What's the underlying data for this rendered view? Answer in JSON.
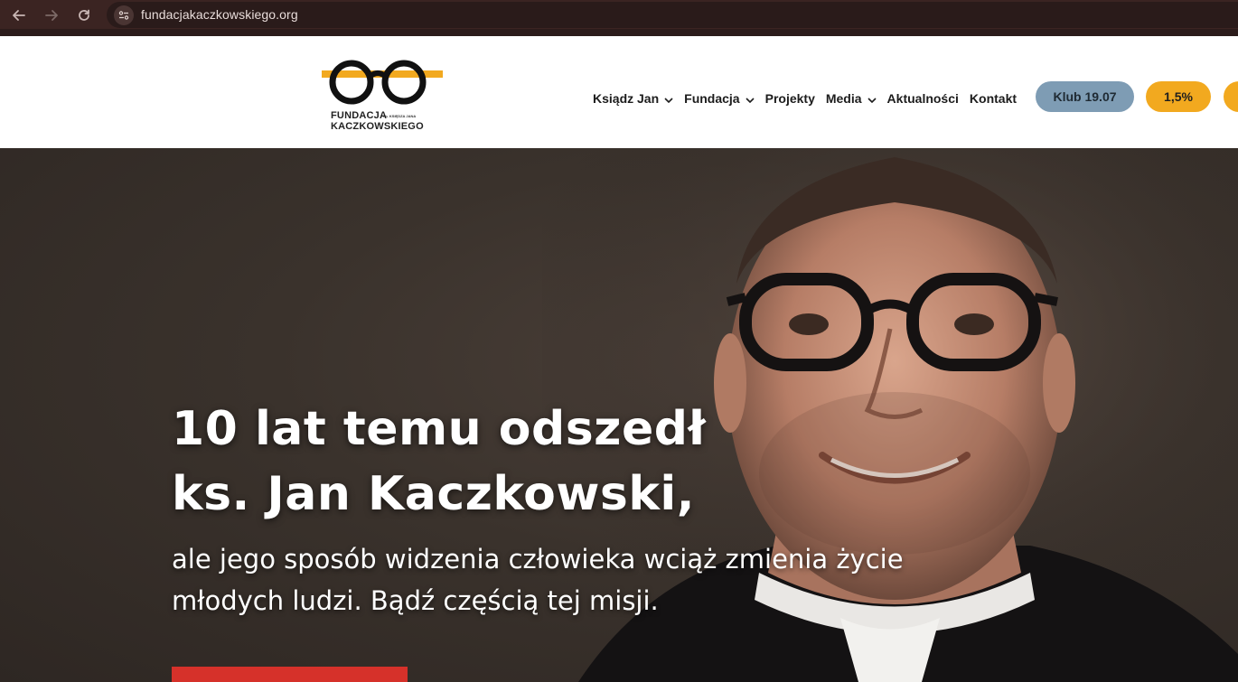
{
  "browser": {
    "url": "fundacjakaczkowskiego.org",
    "back_icon": "arrow-left-icon",
    "forward_icon": "arrow-right-icon",
    "reload_icon": "reload-icon",
    "site_info_icon": "site-settings-icon"
  },
  "logo": {
    "line1": "FUNDACJA",
    "small": "im. KSIĘDZA JANA",
    "line2": "KACZKOWSKIEGO",
    "icon": "glasses-logo-icon",
    "colors": {
      "frame": "#111111",
      "bar": "#f2a91f"
    }
  },
  "nav": {
    "items": [
      {
        "label": "Ksiądz Jan",
        "has_dropdown": true
      },
      {
        "label": "Fundacja",
        "has_dropdown": true
      },
      {
        "label": "Projekty",
        "has_dropdown": false
      },
      {
        "label": "Media",
        "has_dropdown": true
      },
      {
        "label": "Aktualności",
        "has_dropdown": false
      },
      {
        "label": "Kontakt",
        "has_dropdown": false
      }
    ],
    "buttons": {
      "klub": "Klub 19.07",
      "percent": "1,5%"
    },
    "colors": {
      "klub": "#7e9cb4",
      "percent": "#f2a91f"
    }
  },
  "hero": {
    "title_line1": "10 lat temu odszedł",
    "title_line2": "ks. Jan Kaczkowski,",
    "subtitle_line1": "ale jego sposób widzenia człowieka wciąż zmienia życie",
    "subtitle_line2": "młodych ludzi. Bądź częścią tej misji.",
    "cta_color": "#d6312a"
  }
}
